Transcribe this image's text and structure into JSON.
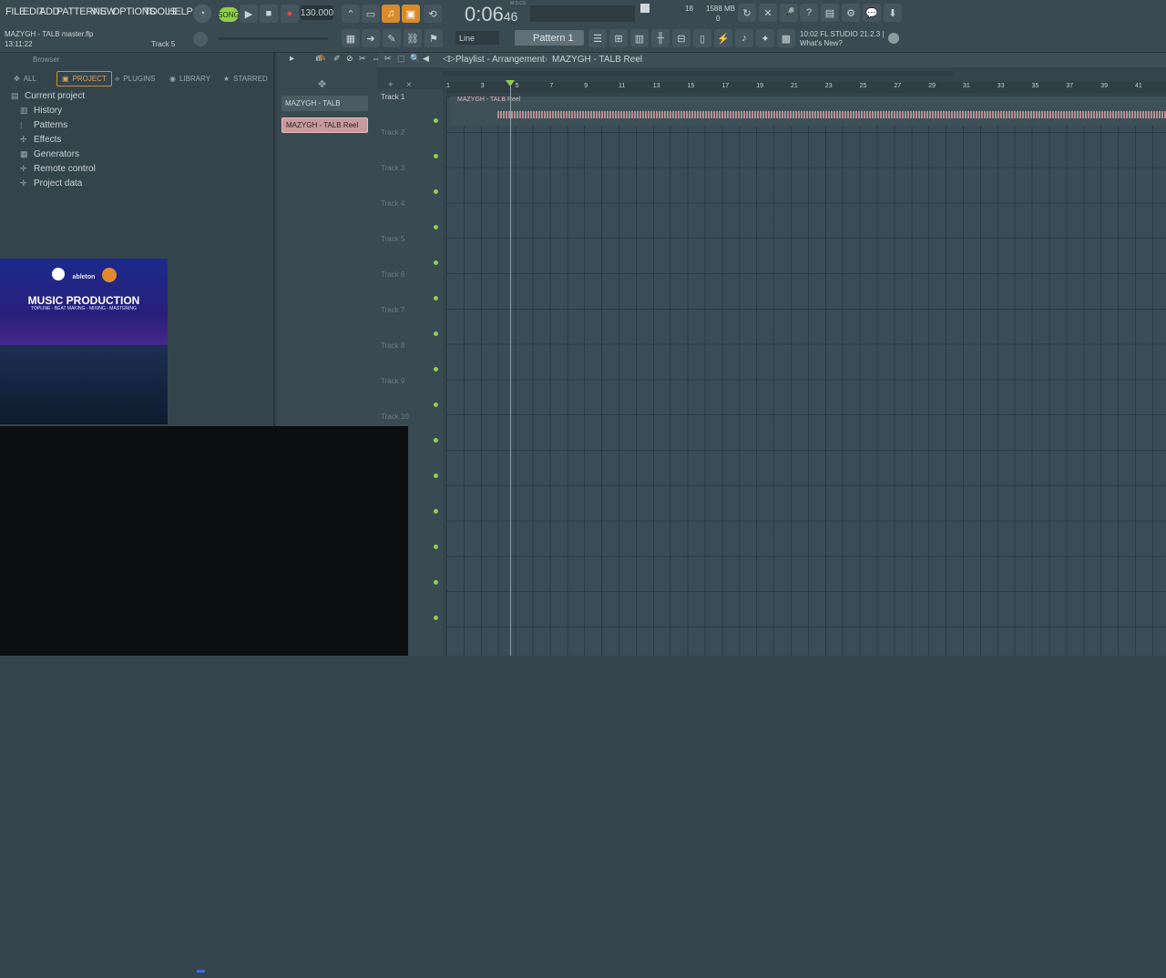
{
  "menu": [
    "FILE",
    "EDIT",
    "ADD",
    "PATTERNS",
    "VIEW",
    "OPTIONS",
    "TOOLS",
    "HELP"
  ],
  "transport": {
    "song_label": "SONG",
    "tempo": "130.000",
    "time_main": "0:06",
    "time_sub": "46",
    "time_caption": "M:S:CS"
  },
  "monitor": {
    "cpu": "18",
    "memory": "1588 MB",
    "polyphony": "0"
  },
  "project": {
    "file": "MAZYGH - TALB master.flp",
    "time": "13:11:22",
    "hint": "Track 5"
  },
  "toolbar": {
    "snap": "Line",
    "pattern": "Pattern 1"
  },
  "news": {
    "version": "10:02  FL STUDIO 21.2.3 |",
    "title": "What's New?"
  },
  "browser": {
    "title": "Browser",
    "tabs": [
      "ALL",
      "PROJECT",
      "PLUGINS",
      "LIBRARY",
      "STARRED"
    ],
    "root": "Current project",
    "items": [
      "History",
      "Patterns",
      "Effects",
      "Generators",
      "Remote control",
      "Project data"
    ]
  },
  "picker": {
    "items": [
      "MAZYGH - TALB",
      "MAZYGH - TALB Reel"
    ]
  },
  "playlist": {
    "title": "Playlist - Arrangement",
    "crumb": "MAZYGH - TALB Reel",
    "clip_label": "MAZYGH - TALB Reel",
    "tracks": [
      "Track 1",
      "Track 2",
      "Track 3",
      "Track 4",
      "Track 5",
      "Track 6",
      "Track 7",
      "Track 8",
      "Track 9",
      "Track 10"
    ],
    "bars": [
      "1",
      "3",
      "5",
      "7",
      "9",
      "11",
      "13",
      "15",
      "17",
      "19",
      "21",
      "23",
      "25",
      "27",
      "29",
      "31",
      "33",
      "35",
      "37",
      "39",
      "41"
    ]
  },
  "ad": {
    "brand": "ableton",
    "title": "MUSIC PRODUCTION",
    "subtitle": "TOPLINE - BEAT MAKING - MIXING - MASTERING"
  },
  "colors": {
    "accent": "#d98a2b",
    "song_mode": "#8fcf4a",
    "clip": "#c89a9e"
  }
}
